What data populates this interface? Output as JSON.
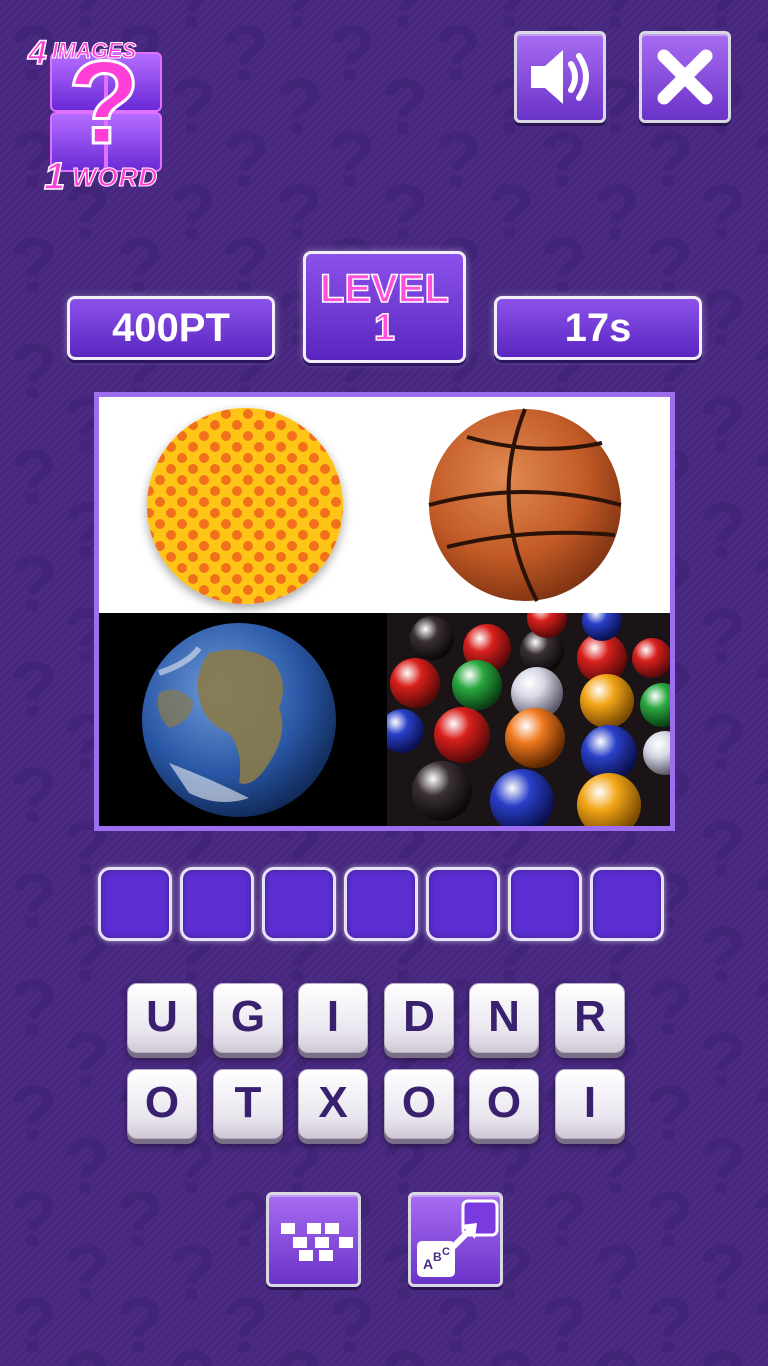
{
  "logo": {
    "four": "4",
    "images": "IMAGES",
    "one": "1",
    "word": "WORD",
    "mark": "?"
  },
  "stats": {
    "score": "400PT",
    "level_label": "LEVEL",
    "level_number": "1",
    "timer": "17s"
  },
  "images": [
    {
      "name": "polka-dot-circle-image",
      "colors": {
        "base": "#ffc515",
        "dots": "#f0701a"
      }
    },
    {
      "name": "basketball-image",
      "colors": {
        "base": "#c9642c"
      }
    },
    {
      "name": "earth-image",
      "colors": {
        "ocean": "#2a58a6",
        "land": "#8a7a4a"
      }
    },
    {
      "name": "marbles-image"
    }
  ],
  "answer_slots": 7,
  "keys": [
    "U",
    "G",
    "I",
    "D",
    "N",
    "R",
    "O",
    "T",
    "X",
    "O",
    "O",
    "I"
  ],
  "icons": {
    "sound": "speaker-icon",
    "close": "close-icon",
    "reveal": "reveal-letters-icon",
    "swap": "abc-swap-icon"
  },
  "colors": {
    "background": "#4a2a82",
    "accent": "#ff4fdc",
    "button": "#8b52ea"
  }
}
